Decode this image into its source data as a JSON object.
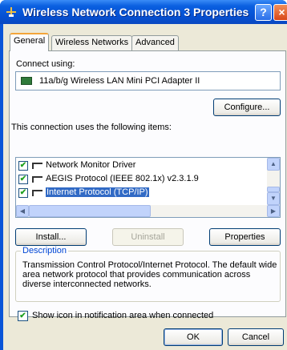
{
  "window": {
    "title": "Wireless Network Connection 3 Properties",
    "help_label": "?",
    "close_label": "×"
  },
  "tabs": [
    {
      "label": "General",
      "active": true
    },
    {
      "label": "Wireless Networks",
      "active": false
    },
    {
      "label": "Advanced",
      "active": false
    }
  ],
  "general": {
    "connect_using_label": "Connect using:",
    "adapter_name": "11a/b/g Wireless LAN Mini PCI Adapter II",
    "configure_button": "Configure...",
    "items_label": "This connection uses the following items:",
    "items": [
      {
        "label": "Network Monitor Driver",
        "checked": true,
        "selected": false
      },
      {
        "label": "AEGIS Protocol (IEEE 802.1x) v2.3.1.9",
        "checked": true,
        "selected": false
      },
      {
        "label": "Internet Protocol (TCP/IP)",
        "checked": true,
        "selected": true
      }
    ],
    "install_button": "Install...",
    "uninstall_button": "Uninstall",
    "properties_button": "Properties",
    "description_legend": "Description",
    "description_text": "Transmission Control Protocol/Internet Protocol. The default wide area network protocol that provides communication across diverse interconnected networks.",
    "show_icon_label": "Show icon in notification area when connected",
    "show_icon_checked": true
  },
  "footer": {
    "ok_button": "OK",
    "cancel_button": "Cancel"
  },
  "colors": {
    "titlebar": "#0550d2",
    "client_bg": "#ece9d8",
    "selection": "#316ac5",
    "group_legend": "#0046d5"
  }
}
